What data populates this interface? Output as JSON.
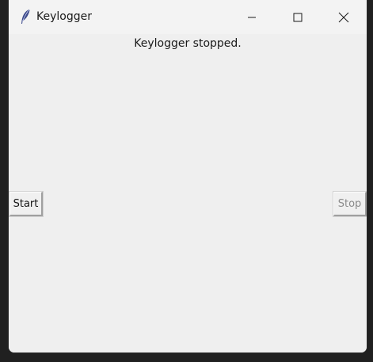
{
  "window": {
    "title": "Keylogger",
    "app_icon": "feather-icon",
    "controls": {
      "minimize_icon": "minimize-icon",
      "maximize_icon": "maximize-icon",
      "close_icon": "close-icon"
    }
  },
  "status_text": "Keylogger stopped.",
  "buttons": {
    "start_label": "Start",
    "stop_label": "Stop",
    "stop_disabled": true
  },
  "colors": {
    "background": "#efefef",
    "titlebar": "#f3f3f3",
    "disabled_text": "#8a8a8a"
  }
}
